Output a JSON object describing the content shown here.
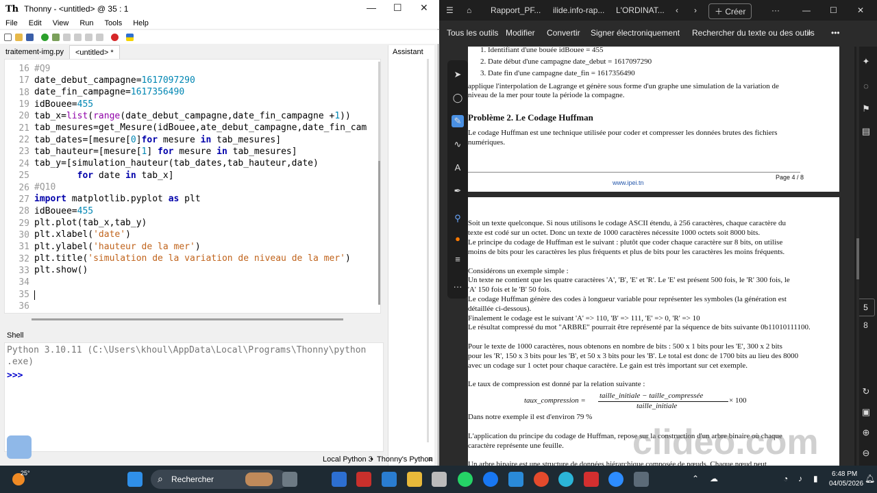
{
  "thonny": {
    "title": "Thonny  -  <untitled>  @  35 : 1",
    "logo": "Th",
    "menu": [
      "File",
      "Edit",
      "View",
      "Run",
      "Tools",
      "Help"
    ],
    "tabs": [
      "traitement-img.py",
      "<untitled> *"
    ],
    "assistant": "Assistant",
    "line_numbers": [
      "16",
      "17",
      "18",
      "19",
      "20",
      "21",
      "22",
      "23",
      "24",
      "25",
      "26",
      "27",
      "28",
      "29",
      "30",
      "31",
      "32",
      "33",
      "34",
      "35",
      "36"
    ],
    "shell_label": "Shell",
    "shell_lines": [
      "Python 3.10.11 (C:\\Users\\khoul\\AppData\\Local\\Programs\\Thonny\\python",
      ".exe)",
      ">>> "
    ],
    "status_left": "Local Python 3",
    "status_sep": "•",
    "status_right": "Thonny's Python",
    "status_menu": "≡"
  },
  "code": {
    "l16": "#Q9",
    "l17a": "date_debut_campagne=",
    "l17b": "1617097290",
    "l18a": "date_fin_campagne=",
    "l18b": "1617356490",
    "l19a": "idBouee=",
    "l19b": "455",
    "l20a": "tab_x=",
    "l20b": "list",
    "l20c": "(",
    "l20d": "range",
    "l20e": "(date_debut_campagne,date_fin_campagne +",
    "l20f": "1",
    "l20g": "))",
    "l21": "tab_mesures=get_Mesure(idBouee,ate_debut_campagne,date_fin_cam",
    "l22a": "tab_dates=[mesure[",
    "l22b": "0",
    "l22c": "]",
    "l22d": "for",
    "l22e": " mesure ",
    "l22f": "in",
    "l22g": " tab_mesures]",
    "l23a": "tab_hauteur=[mesure[",
    "l23b": "1",
    "l23c": "] ",
    "l23d": "for",
    "l23e": " mesure ",
    "l23f": "in",
    "l23g": " tab_mesures]",
    "l24": "tab_y=[simulation_hauteur(tab_dates,tab_hauteur,date)",
    "l25a": "        ",
    "l25b": "for",
    "l25c": " date ",
    "l25d": "in",
    "l25e": " tab_x]",
    "l26": "#Q10",
    "l27a": "import",
    "l27b": " matplotlib.pyplot ",
    "l27c": "as",
    "l27d": " plt",
    "l28a": "idBouee=",
    "l28b": "455",
    "l29": "plt.plot(tab_x,tab_y)",
    "l30a": "plt.xlabel(",
    "l30b": "'date'",
    "l30c": ")",
    "l31a": "plt.ylabel(",
    "l31b": "'hauteur de la mer'",
    "l31c": ")",
    "l32a": "plt.title(",
    "l32b": "'simulation de la variation de niveau de la mer'",
    "l32c": ")",
    "l33": "plt.show()"
  },
  "browser": {
    "tabs": [
      "Rapport_PF...",
      "ilide.info-rap...",
      "L'ORDINAT..."
    ],
    "create": "Créer",
    "tools": [
      "Tous les outils",
      "Modifier",
      "Convertir",
      "Signer électroniquement",
      "Rechercher du texte ou des outils"
    ],
    "page_num": "5",
    "page_total": "8"
  },
  "pdf": {
    "l1": "1.  Identifiant d'une bouée idBouee = 455",
    "l2": "2.  Date début d'une campagne date_debut = 1617097290",
    "l3": "3.  Date fin d'une campagne date_fin = 1617356490",
    "l4": "applique l'interpolation de Lagrange et génère sous forme d'un graphe une simulation de la variation de",
    "l5": "niveau de la mer pour toute la période la compagne.",
    "h2": "Problème 2. Le Codage Huffman",
    "l6": "Le codage Huffman est une technique utilisée pour coder et compresser les données brutes des fichiers",
    "l7": "numériques.",
    "footer_page": "Page 4 / 8",
    "footer_site": "www.ipei.tn",
    "p1": "Soit un texte quelconque. Si nous utilisons le codage ASCII étendu, à 256 caractères, chaque caractère du",
    "p2": "texte est codé sur un octet. Donc un texte de 1000 caractères nécessite 1000 octets soit 8000 bits.",
    "p3": "Le principe du codage de Huffman est le suivant : plutôt que coder chaque caractère sur 8 bits, on utilise",
    "p4": "moins de bits pour les caractères les plus fréquents et plus de bits pour les caractères les moins fréquents.",
    "p5": "Considérons un exemple simple :",
    "p6": "Un texte ne contient que les quatre caractères 'A', 'B', 'E' et 'R'. Le 'E' est présent 500 fois, le 'R' 300 fois, le",
    "p7": "'A' 150 fois et le 'B' 50 fois.",
    "p8": "Le codage Huffman génère des codes à longueur variable pour représenter les symboles (la génération est",
    "p9": "détaillée ci-dessous).",
    "p10": "Finalement le codage est le suivant 'A' => 110, 'B' => 111, 'E' => 0, 'R' => 10",
    "p11": "Le résultat compressé du mot \"ARBRE\" pourrait être représenté par la séquence de bits suivante 0b11010111100.",
    "p12": "Pour le texte de 1000 caractères, nous obtenons en nombre de bits : 500 x 1 bits pour les 'E', 300 x 2 bits",
    "p13": "pour les 'R', 150 x 3 bits pour les 'B', et 50 x 3 bits pour les 'B'. Le total est donc de 1700 bits au lieu des 8000",
    "p14": "avec un codage sur 1 octet pour chaque caractère. Le gain est très important sur cet exemple.",
    "p15": "Le taux de compression est donné par la relation suivante :",
    "f_lhs": "taux_compression =",
    "f_num": "taille_initiale − taille_compressée",
    "f_den": "taille_initiale",
    "f_mul": "× 100",
    "p16": "Dans notre exemple il est d'environ 79 %",
    "p17": "L'application du principe du codage de Huffman, repose sur la construction d'un arbre binaire où chaque",
    "p18": "caractère représente une feuille.",
    "p19": "Un arbre binaire est une structure de données hiérarchique composée de nœuds. Chaque nœud peut",
    "watermark": "clideo.com"
  },
  "taskbar": {
    "weather": "25°",
    "search": "Rechercher",
    "time": "6:48 PM",
    "date": "04/05/2026"
  }
}
